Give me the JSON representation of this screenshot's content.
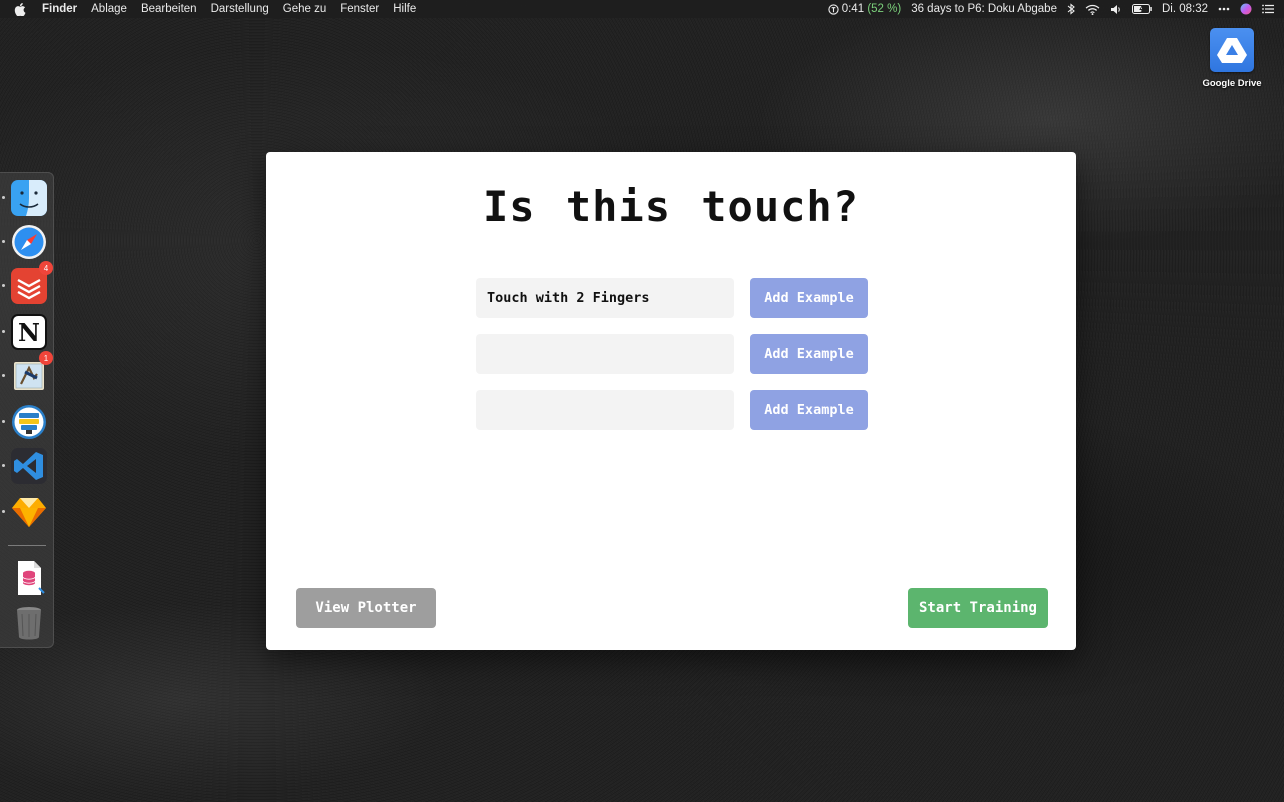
{
  "menubar": {
    "app_name": "Finder",
    "items": [
      "Ablage",
      "Bearbeiten",
      "Darstellung",
      "Gehe zu",
      "Fenster",
      "Hilfe"
    ],
    "timer": "0:41",
    "timer_pct": "(52 %)",
    "countdown": "36 days to P6: Doku Abgabe",
    "clock": "Di. 08:32",
    "icons": [
      "apple-logo",
      "timer-icon",
      "bluetooth-icon",
      "wifi-icon",
      "volume-icon",
      "battery-icon",
      "more-icon",
      "siri-icon",
      "control-center-icon"
    ]
  },
  "desktop": {
    "icons": [
      {
        "label": "Google Drive",
        "icon": "google-drive-icon"
      }
    ]
  },
  "dock": {
    "apps": [
      {
        "name": "finder",
        "badge": "",
        "running": true
      },
      {
        "name": "safari",
        "badge": "",
        "running": true
      },
      {
        "name": "todoist",
        "badge": "4",
        "running": true
      },
      {
        "name": "notion",
        "badge": "",
        "running": true
      },
      {
        "name": "mail",
        "badge": "1",
        "running": true
      },
      {
        "name": "sourcetree",
        "badge": "",
        "running": true
      },
      {
        "name": "vscode",
        "badge": "",
        "running": true
      },
      {
        "name": "sketch",
        "badge": "",
        "running": true
      },
      {
        "name": "sql-document",
        "badge": "",
        "running": false
      },
      {
        "name": "trash",
        "badge": "",
        "running": false
      }
    ]
  },
  "window": {
    "title": "Is this touch?",
    "classes": [
      {
        "value": "Touch with 2 Fingers",
        "placeholder": "",
        "button": "Add Example"
      },
      {
        "value": "",
        "placeholder": "",
        "button": "Add Example"
      },
      {
        "value": "",
        "placeholder": "",
        "button": "Add Example"
      }
    ],
    "view_plotter": "View Plotter",
    "start_training": "Start Training"
  },
  "colors": {
    "add_button": "#8fa2e3",
    "plotter_button": "#9e9e9e",
    "train_button": "#5cb56e",
    "input_bg": "#f3f3f3"
  }
}
